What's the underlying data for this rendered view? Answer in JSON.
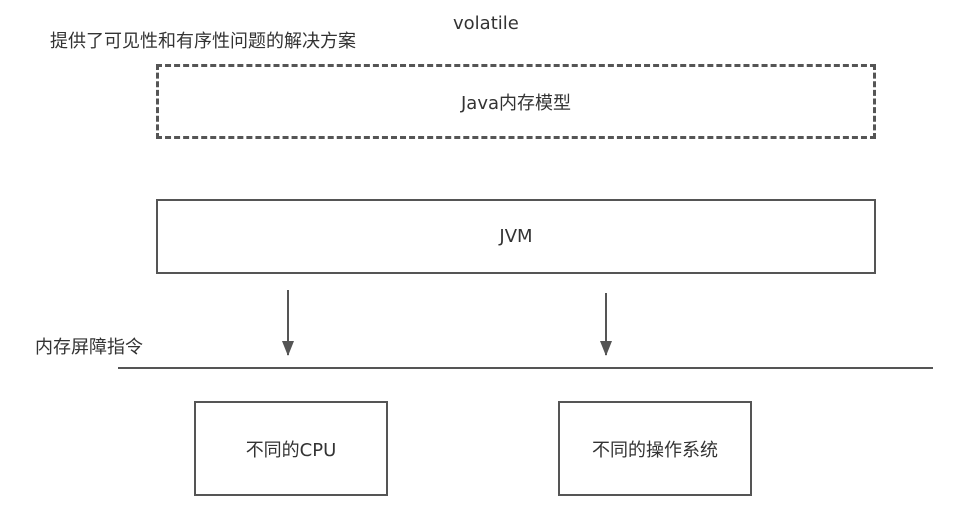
{
  "title": "volatile",
  "subtitle": "提供了可见性和有序性问题的解决方案",
  "jmm_box": {
    "label": "Java内存模型"
  },
  "jvm_box": {
    "label": "JVM"
  },
  "barrier_label": "内存屏障指令",
  "cpu_box": {
    "label": "不同的CPU"
  },
  "os_box": {
    "label": "不同的操作系统"
  },
  "colors": {
    "stroke": "#555555",
    "text": "#333333"
  }
}
